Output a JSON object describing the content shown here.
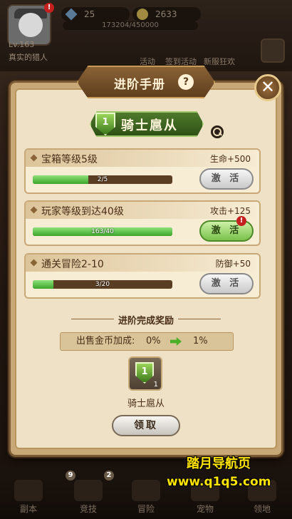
{
  "hud": {
    "level": "Lv.163",
    "player_name": "真实的猎人",
    "gems": "25",
    "gold": "2633",
    "exp_text": "173204/450000",
    "nav_top": [
      "活动",
      "签到活动",
      "新服狂欢"
    ]
  },
  "modal": {
    "title": "进阶手册",
    "help": "?",
    "close": "✕",
    "rank_number": "1",
    "rank_name": "骑士扈从",
    "tasks": [
      {
        "label": "宝箱等级5级",
        "reward": "生命+500",
        "progress_text": "2/5",
        "progress": 0.4,
        "button": "激 活",
        "button_style": "gray",
        "alert": false
      },
      {
        "label": "玩家等级到达40级",
        "reward": "攻击+125",
        "progress_text": "163/40",
        "progress": 1.0,
        "button": "激 活",
        "button_style": "green",
        "alert": true
      },
      {
        "label": "通关冒险2-10",
        "reward": "防御+50",
        "progress_text": "3/20",
        "progress": 0.15,
        "button": "激 活",
        "button_style": "gray",
        "alert": false
      }
    ],
    "section_title": "进阶完成奖励",
    "bonus": {
      "label": "出售金币加成:",
      "from": "0%",
      "to": "1%"
    },
    "reward": {
      "count": "1",
      "name": "骑士扈从"
    },
    "claim": "领取"
  },
  "bottom_nav": [
    "副本",
    "竞技",
    "冒险",
    "宠物",
    "领地"
  ],
  "badges": {
    "pvp_count": "9",
    "pvp_count2": "2"
  },
  "watermark": {
    "line1": "踏月导航页",
    "line2": "www.q1q5.com"
  }
}
